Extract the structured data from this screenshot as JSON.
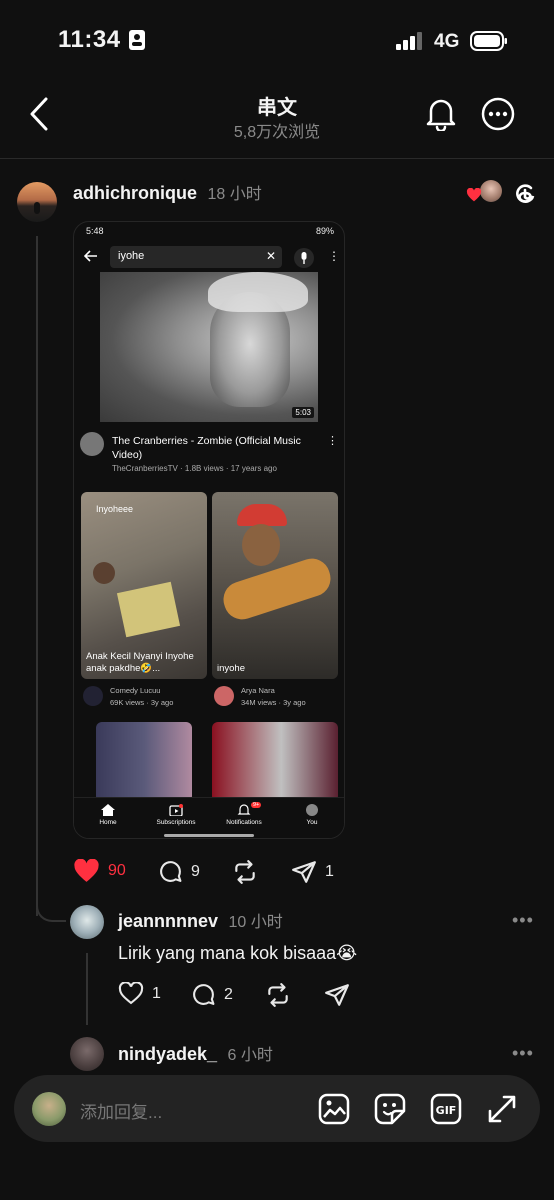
{
  "status_bar": {
    "time": "11:34",
    "network": "4G"
  },
  "header": {
    "title": "串文",
    "views": "5,8万次浏览"
  },
  "post": {
    "author": "adhichronique",
    "time": "18 小时",
    "phone": {
      "status_time": "5:48",
      "battery": "89%",
      "search_query": "iyohe",
      "video_duration": "5:03",
      "video_title": "The Cranberries - Zombie (Official Music Video)",
      "channel_line": "TheCranberriesTV · 1.8B views · 17 years ago",
      "shorts": [
        {
          "overlay": "Inyoheee",
          "caption": "Anak Kecil Nyanyi Inyohe anak pakdhe🤣...",
          "channel": "Comedy Lucuu",
          "stats": "69K views · 3y ago"
        },
        {
          "overlay": "",
          "caption": "inyohe",
          "channel": "Arya Nara",
          "stats": "34M views · 3y ago"
        }
      ],
      "nav": [
        "Home",
        "Subscriptions",
        "Notifications",
        "You"
      ],
      "notif_badge": "9+"
    },
    "likes": "90",
    "comments": "9",
    "shares": "1"
  },
  "replies": [
    {
      "author": "jeannnnnev",
      "time": "10 小时",
      "text": "Lirik yang mana kok bisaaa😭",
      "likes": "1",
      "comments": "2"
    },
    {
      "author": "nindyadek_",
      "time": "6 小时"
    }
  ],
  "composer": {
    "placeholder": "添加回复..."
  },
  "colors": {
    "background": "#101010",
    "like_red": "#ff3040",
    "muted": "#8a8a8a"
  }
}
